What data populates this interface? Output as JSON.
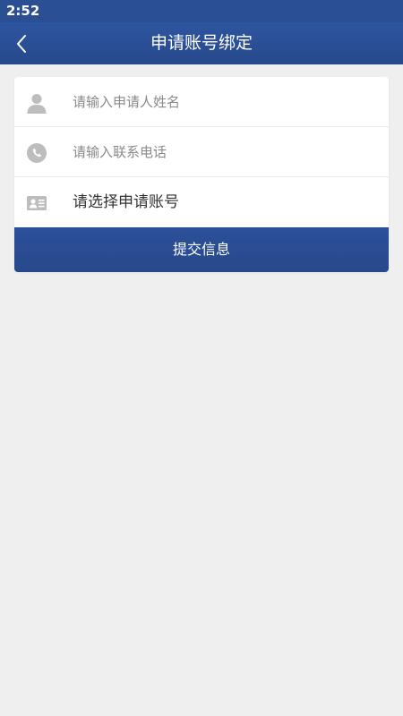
{
  "status_bar": {
    "time": "2:52"
  },
  "header": {
    "title": "申请账号绑定",
    "back_icon": "chevron-left-icon"
  },
  "form": {
    "name_placeholder": "请输入申请人姓名",
    "name_icon": "person-icon",
    "phone_placeholder": "请输入联系电话",
    "phone_icon": "phone-icon",
    "account_label": "请选择申请账号",
    "account_icon": "id-card-icon",
    "submit_label": "提交信息"
  },
  "colors": {
    "primary": "#2a4f93",
    "background": "#efefef",
    "icon_gray": "#bdbdbd"
  }
}
